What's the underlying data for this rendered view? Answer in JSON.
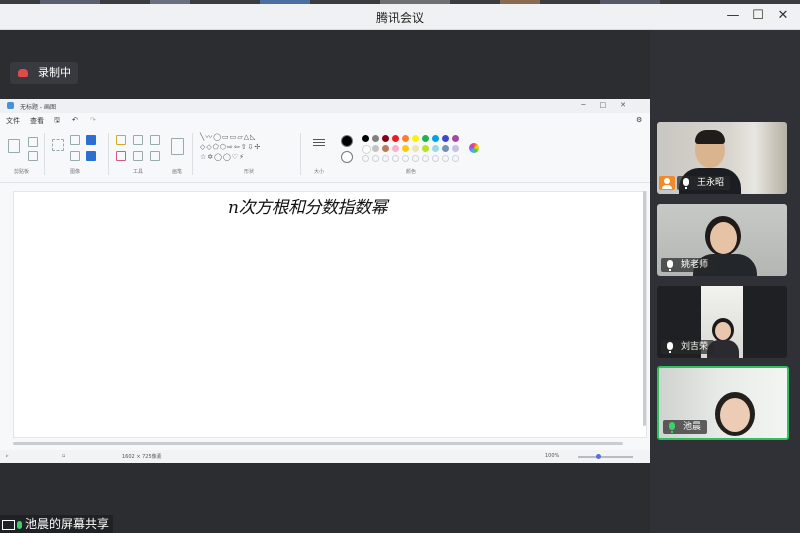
{
  "window": {
    "title": "腾讯会议",
    "controls": {
      "minimize": "—",
      "maximize": "☐",
      "close": "✕"
    }
  },
  "recording": {
    "label": "录制中"
  },
  "paint": {
    "title": "无标题 - 画图",
    "menu": [
      "文件",
      "查看"
    ],
    "groups": {
      "clipboard": "剪贴板",
      "image": "图像",
      "tools": "工具",
      "brush": "画笔",
      "shapes": "形状",
      "size": "大小",
      "colors": "颜色"
    },
    "canvas_text": "n次方根和分数指数幂",
    "status": {
      "size": "1602 × 725像素",
      "zoom": "100%"
    },
    "palette": [
      "#000000",
      "#7f7f7f",
      "#880015",
      "#ed1c24",
      "#ff7f27",
      "#fff200",
      "#22b14c",
      "#00a2e8",
      "#3f48cc",
      "#a349a4",
      "#ffffff",
      "#c3c3c3",
      "#b97a57",
      "#ffaec9",
      "#ffc90e",
      "#efe4b0",
      "#b5e61d",
      "#99d9ea",
      "#7092be",
      "#c8bfe7"
    ]
  },
  "participants": [
    {
      "name": "王永昭",
      "is_host": true,
      "active": false
    },
    {
      "name": "姚老师",
      "is_host": false,
      "active": false
    },
    {
      "name": "刘吉荣",
      "is_host": false,
      "active": false
    },
    {
      "name": "池晨",
      "is_host": false,
      "active": true
    }
  ],
  "share_label": "池晨的屏幕共享",
  "colors": {
    "accent_green": "#2ec15d",
    "record_red": "#e24a4a",
    "host_orange": "#f08a2a"
  }
}
